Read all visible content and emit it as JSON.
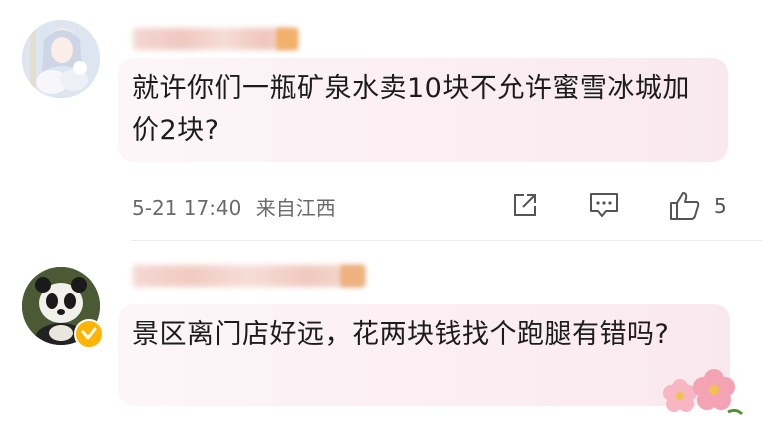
{
  "comments": [
    {
      "username": "",
      "text": "就许你们一瓶矿泉水卖10块不允许蜜雪冰城加价2块?",
      "date": "5-21 17:40",
      "location": "来自江西",
      "like_count": "5",
      "avatar_icon": "anime-avatar",
      "action_icons": [
        "share-icon",
        "reply-icon",
        "like-icon"
      ]
    },
    {
      "username": "",
      "text": "景区离门店好远，花两块钱找个跑腿有错吗?",
      "avatar_icon": "panda-avatar",
      "badge_icon": "verified-badge-icon",
      "decoration_icon": "flower-decoration-icon"
    }
  ],
  "colors": {
    "bubble_bg": "#fbeef2",
    "verified_badge": "#ffb400",
    "meta_text": "#6a6a6a"
  }
}
